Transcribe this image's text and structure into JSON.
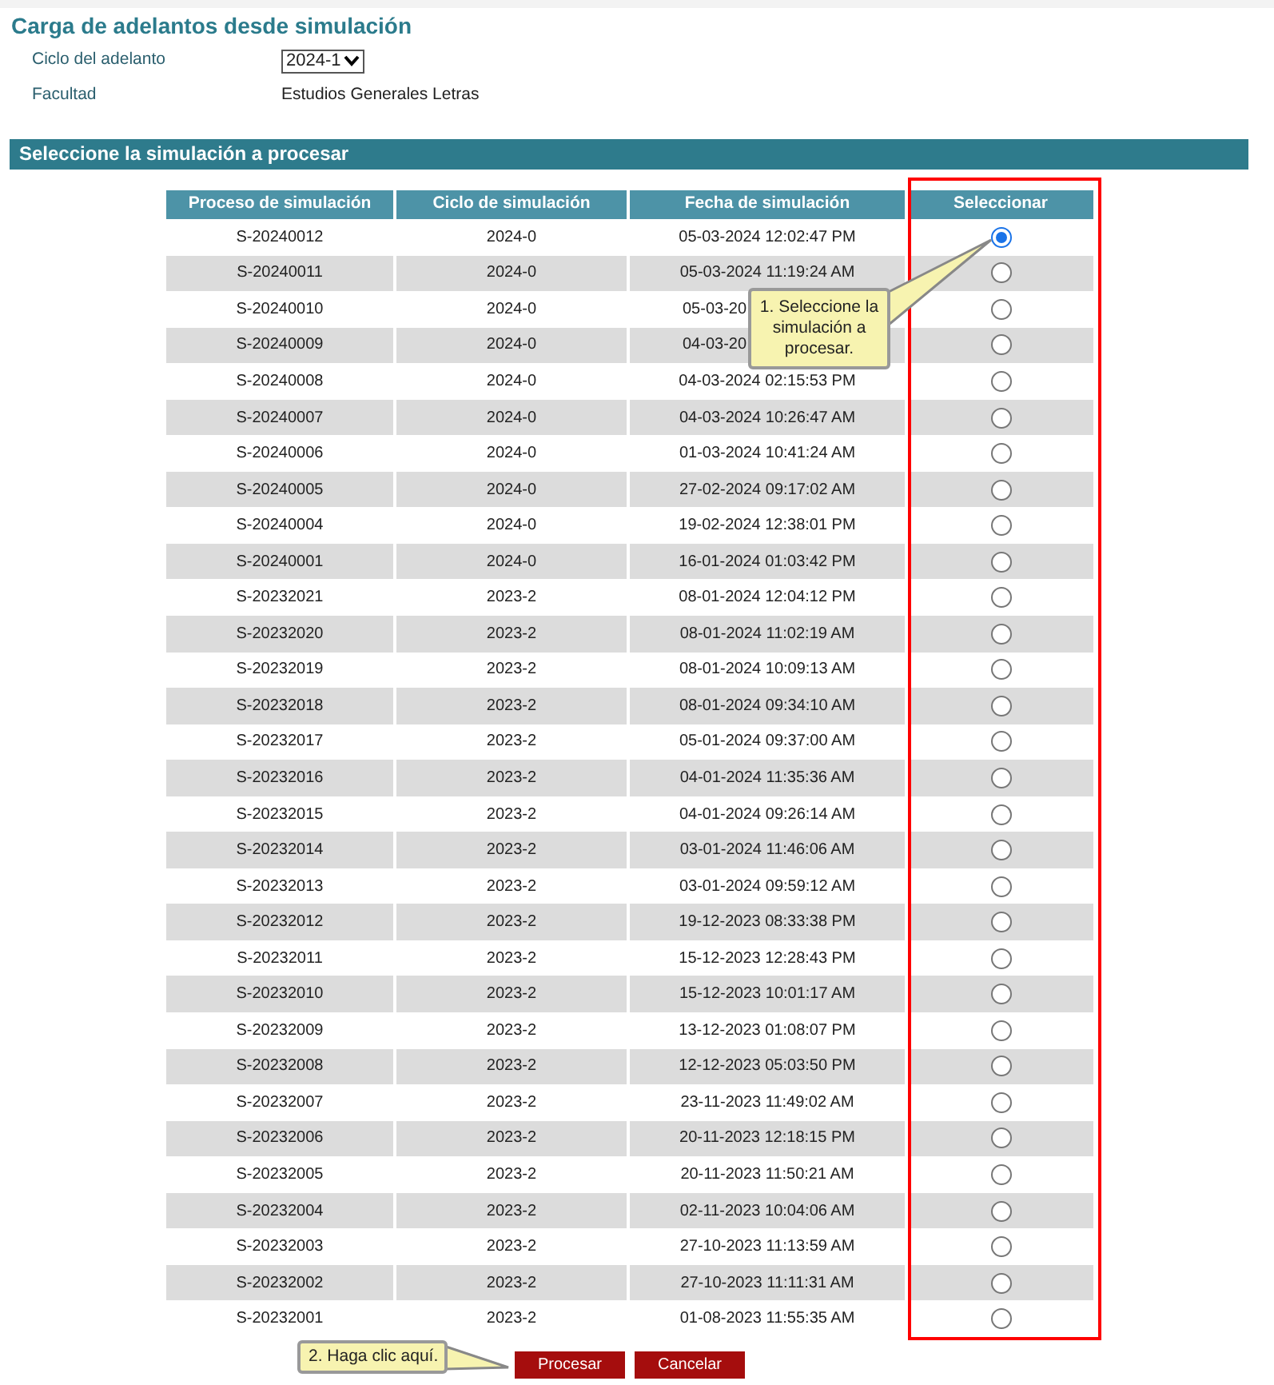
{
  "title": "Carga de adelantos desde simulación",
  "form": [
    {
      "label": "Ciclo del adelanto",
      "kind": "select",
      "value": "2024-1"
    },
    {
      "label": "Facultad",
      "kind": "text",
      "value": "Estudios Generales Letras"
    }
  ],
  "section_title": "Seleccione la simulación a procesar",
  "table": {
    "columns": [
      "Proceso de simulación",
      "Ciclo de simulación",
      "Fecha de simulación",
      "Seleccionar"
    ],
    "rows": [
      {
        "proceso": "S-20240012",
        "ciclo": "2024-0",
        "fecha": "05-03-2024 12:02:47 PM",
        "selected": true
      },
      {
        "proceso": "S-20240011",
        "ciclo": "2024-0",
        "fecha": "05-03-2024 11:19:24 AM",
        "selected": false
      },
      {
        "proceso": "S-20240010",
        "ciclo": "2024-0",
        "fecha": "05-03-20",
        "selected": false
      },
      {
        "proceso": "S-20240009",
        "ciclo": "2024-0",
        "fecha": "04-03-20",
        "selected": false
      },
      {
        "proceso": "S-20240008",
        "ciclo": "2024-0",
        "fecha": "04-03-2024 02:15:53 PM",
        "selected": false
      },
      {
        "proceso": "S-20240007",
        "ciclo": "2024-0",
        "fecha": "04-03-2024 10:26:47 AM",
        "selected": false
      },
      {
        "proceso": "S-20240006",
        "ciclo": "2024-0",
        "fecha": "01-03-2024 10:41:24 AM",
        "selected": false
      },
      {
        "proceso": "S-20240005",
        "ciclo": "2024-0",
        "fecha": "27-02-2024 09:17:02 AM",
        "selected": false
      },
      {
        "proceso": "S-20240004",
        "ciclo": "2024-0",
        "fecha": "19-02-2024 12:38:01 PM",
        "selected": false
      },
      {
        "proceso": "S-20240001",
        "ciclo": "2024-0",
        "fecha": "16-01-2024 01:03:42 PM",
        "selected": false
      },
      {
        "proceso": "S-20232021",
        "ciclo": "2023-2",
        "fecha": "08-01-2024 12:04:12 PM",
        "selected": false
      },
      {
        "proceso": "S-20232020",
        "ciclo": "2023-2",
        "fecha": "08-01-2024 11:02:19 AM",
        "selected": false
      },
      {
        "proceso": "S-20232019",
        "ciclo": "2023-2",
        "fecha": "08-01-2024 10:09:13 AM",
        "selected": false
      },
      {
        "proceso": "S-20232018",
        "ciclo": "2023-2",
        "fecha": "08-01-2024 09:34:10 AM",
        "selected": false
      },
      {
        "proceso": "S-20232017",
        "ciclo": "2023-2",
        "fecha": "05-01-2024 09:37:00 AM",
        "selected": false
      },
      {
        "proceso": "S-20232016",
        "ciclo": "2023-2",
        "fecha": "04-01-2024 11:35:36 AM",
        "selected": false
      },
      {
        "proceso": "S-20232015",
        "ciclo": "2023-2",
        "fecha": "04-01-2024 09:26:14 AM",
        "selected": false
      },
      {
        "proceso": "S-20232014",
        "ciclo": "2023-2",
        "fecha": "03-01-2024 11:46:06 AM",
        "selected": false
      },
      {
        "proceso": "S-20232013",
        "ciclo": "2023-2",
        "fecha": "03-01-2024 09:59:12 AM",
        "selected": false
      },
      {
        "proceso": "S-20232012",
        "ciclo": "2023-2",
        "fecha": "19-12-2023 08:33:38 PM",
        "selected": false
      },
      {
        "proceso": "S-20232011",
        "ciclo": "2023-2",
        "fecha": "15-12-2023 12:28:43 PM",
        "selected": false
      },
      {
        "proceso": "S-20232010",
        "ciclo": "2023-2",
        "fecha": "15-12-2023 10:01:17 AM",
        "selected": false
      },
      {
        "proceso": "S-20232009",
        "ciclo": "2023-2",
        "fecha": "13-12-2023 01:08:07 PM",
        "selected": false
      },
      {
        "proceso": "S-20232008",
        "ciclo": "2023-2",
        "fecha": "12-12-2023 05:03:50 PM",
        "selected": false
      },
      {
        "proceso": "S-20232007",
        "ciclo": "2023-2",
        "fecha": "23-11-2023 11:49:02 AM",
        "selected": false
      },
      {
        "proceso": "S-20232006",
        "ciclo": "2023-2",
        "fecha": "20-11-2023 12:18:15 PM",
        "selected": false
      },
      {
        "proceso": "S-20232005",
        "ciclo": "2023-2",
        "fecha": "20-11-2023 11:50:21 AM",
        "selected": false
      },
      {
        "proceso": "S-20232004",
        "ciclo": "2023-2",
        "fecha": "02-11-2023 10:04:06 AM",
        "selected": false
      },
      {
        "proceso": "S-20232003",
        "ciclo": "2023-2",
        "fecha": "27-10-2023 11:13:59 AM",
        "selected": false
      },
      {
        "proceso": "S-20232002",
        "ciclo": "2023-2",
        "fecha": "27-10-2023 11:11:31 AM",
        "selected": false
      },
      {
        "proceso": "S-20232001",
        "ciclo": "2023-2",
        "fecha": "01-08-2023 11:55:35 AM",
        "selected": false
      }
    ]
  },
  "callouts": [
    "1. Seleccione la simulación a procesar.",
    "2. Haga clic aquí."
  ],
  "buttons": [
    "Procesar",
    "Cancelar"
  ]
}
